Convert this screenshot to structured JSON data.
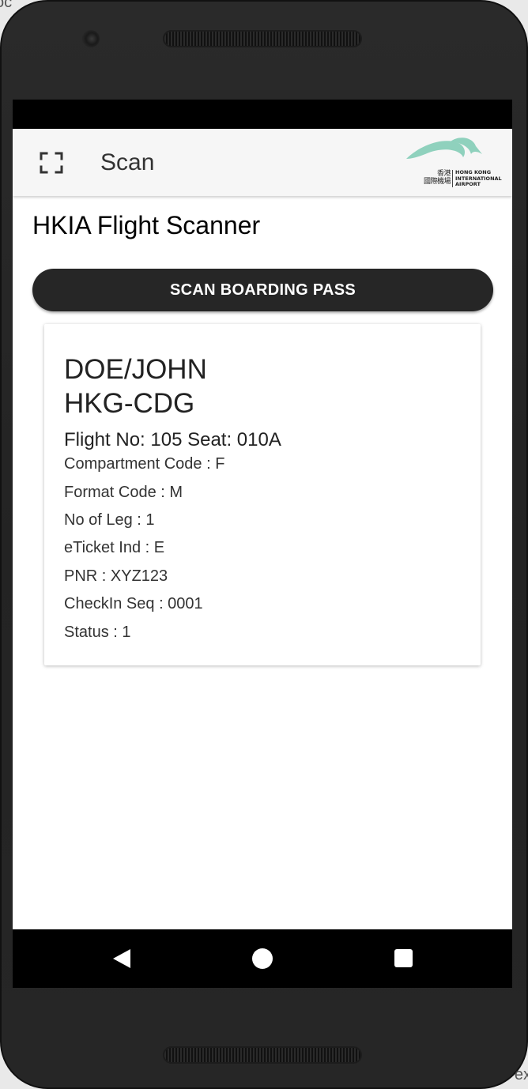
{
  "app": {
    "title": "Scan",
    "heading": "HKIA Flight Scanner",
    "scan_button_label": "SCAN BOARDING PASS"
  },
  "logo": {
    "chinese_line1": "香港",
    "chinese_line2": "國際機場",
    "english_lines": [
      "HONG KONG",
      "INTERNATIONAL",
      "AIRPORT"
    ],
    "colors": {
      "mark": "#8fd1bd"
    }
  },
  "boarding_pass": {
    "name": "DOE/JOHN",
    "route": "HKG-CDG",
    "flight_line": "Flight No: 105 Seat: 010A",
    "details": [
      "Compartment Code : F",
      "Format Code : M",
      "No of Leg : 1",
      "eTicket Ind : E",
      "PNR : XYZ123",
      "CheckIn Seq : 0001",
      "Status : 1"
    ]
  },
  "icons": {
    "app_bar": "scan-frame-icon",
    "nav": [
      "back-triangle-icon",
      "home-circle-icon",
      "recents-square-icon"
    ]
  },
  "background_text": {
    "top_left": "oc",
    "bottom_right": "ex"
  }
}
